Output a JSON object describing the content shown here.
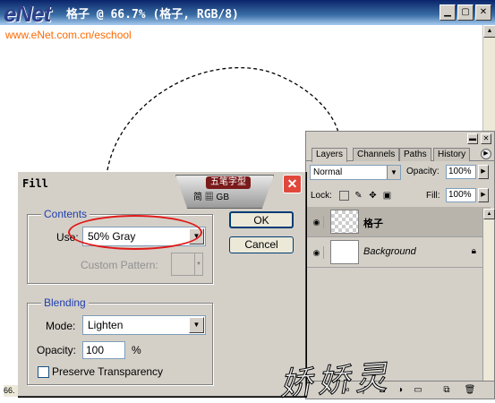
{
  "document": {
    "title": "格子 @ 66.7% (格子, RGB/8)",
    "logo": "eNet",
    "watermark": "www.eNet.com.cn/eschool",
    "status_zoom": "66.",
    "window_buttons": {
      "minimize": "▁",
      "maximize": "▢",
      "close": "✕"
    }
  },
  "layers_palette": {
    "tabs": [
      "Layers",
      "Channels",
      "Paths",
      "History"
    ],
    "active_tab": "Layers",
    "blend_mode": "Normal",
    "opacity_label": "Opacity:",
    "opacity_value": "100%",
    "lock_label": "Lock:",
    "fill_label": "Fill:",
    "fill_value": "100%",
    "layers": [
      {
        "name": "格子",
        "selected": true,
        "thumbnail": "transparent",
        "locked": false
      },
      {
        "name": "Background",
        "selected": false,
        "thumbnail": "white",
        "locked": true
      }
    ],
    "icons": [
      "eye-icon",
      "lock-icon",
      "link-icon",
      "fx-icon",
      "mask-icon",
      "adjustment-icon",
      "folder-icon",
      "new-layer-icon",
      "trash-icon"
    ]
  },
  "fill_dialog": {
    "title": "Fill",
    "ime_bar": {
      "label": "五笔字型",
      "sub": "简 ▦ GB"
    },
    "contents": {
      "group_label": "Contents",
      "use_label": "Use:",
      "use_value": "50% Gray",
      "custom_pattern_label": "Custom Pattern:"
    },
    "blending": {
      "group_label": "Blending",
      "mode_label": "Mode:",
      "mode_value": "Lighten",
      "opacity_label": "Opacity:",
      "opacity_value": "100",
      "opacity_unit": "%",
      "preserve_label": "Preserve Transparency",
      "preserve_checked": false
    },
    "ok_label": "OK",
    "cancel_label": "Cancel"
  },
  "signature": "娇娇灵",
  "accent_colors": {
    "group_label": "#1f3fae",
    "highlight": "#e01818",
    "watermark": "#ff6a00"
  }
}
